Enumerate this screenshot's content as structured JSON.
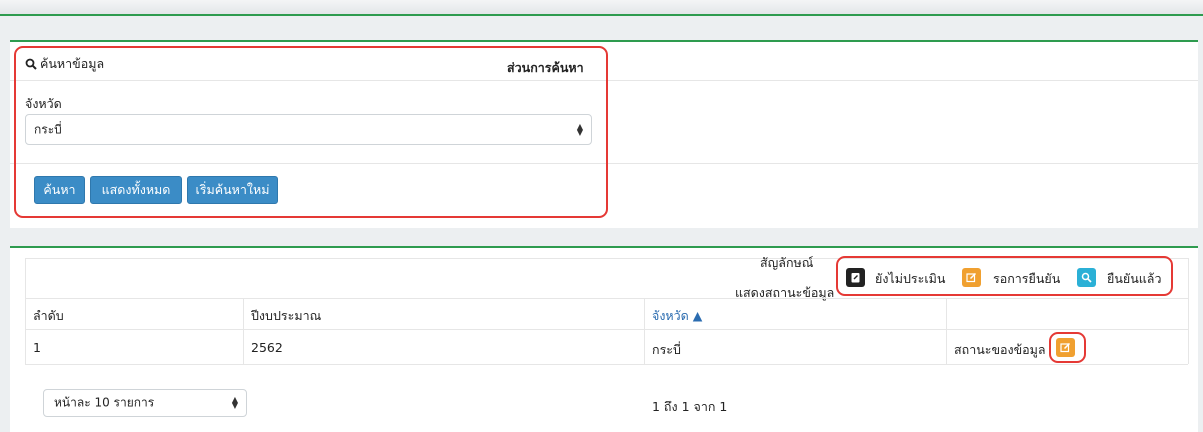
{
  "search_panel": {
    "title": "ค้นหาข้อมูล",
    "section_label": "ส่วนการค้นหา",
    "province_label": "จังหวัด",
    "province_value": "กระบี่",
    "buttons": {
      "search": "ค้นหา",
      "show_all": "แสดงทั้งหมด",
      "reset": "เริ่มค้นหาใหม่"
    }
  },
  "legend": {
    "title_line1": "สัญลักษณ์",
    "title_line2": "แสดงสถานะข้อมูล",
    "items": [
      {
        "label": "ยังไม่ประเมิน",
        "color": "#222222",
        "icon": "clipboard-icon"
      },
      {
        "label": "รอการยืนยัน",
        "color": "#f0a030",
        "icon": "edit-icon"
      },
      {
        "label": "ยืนยันแล้ว",
        "color": "#2bb0d6",
        "icon": "search-icon"
      }
    ]
  },
  "table": {
    "columns": [
      "ลำดับ",
      "ปีงบประมาณ",
      "จังหวัด ▲",
      ""
    ],
    "rows": [
      {
        "index": "1",
        "year": "2562",
        "province": "กระบี่",
        "status_label": "สถานะของข้อมูล",
        "status_color": "#f0a030",
        "status_icon": "edit-icon"
      }
    ]
  },
  "footer": {
    "page_size": "หน้าละ 10 รายการ",
    "info": "1 ถึง 1 จาก 1"
  }
}
